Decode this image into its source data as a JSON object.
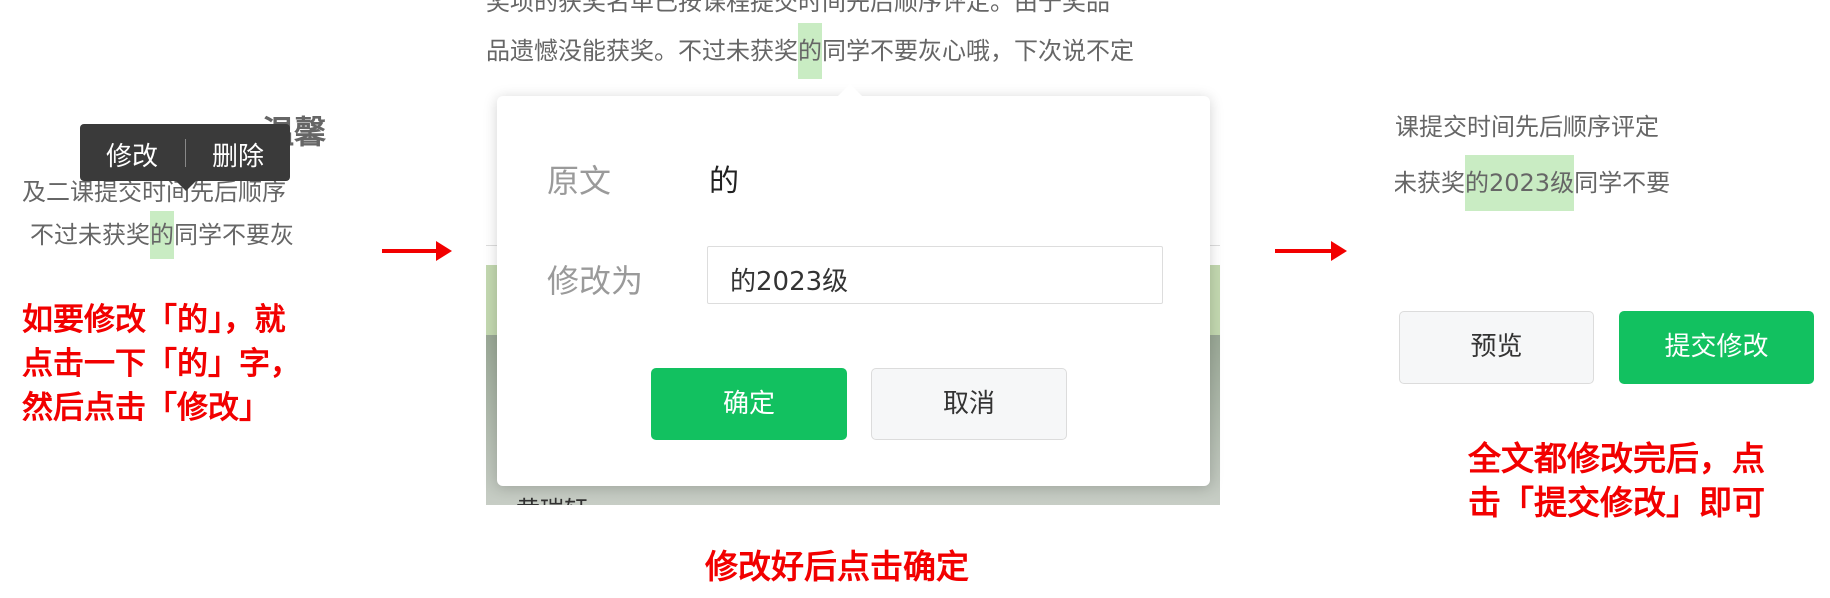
{
  "panel1": {
    "heading_fragment": "温馨",
    "tooltip": {
      "edit_label": "修改",
      "delete_label": "删除"
    },
    "line1": "及二课提交时间先后顺序",
    "line2_before": "不过未获奖",
    "line2_highlight": "的",
    "line2_after": "同学不要灰",
    "instruction": [
      "如要修改「的」，就",
      "点击一下「的」字，",
      "然后点击「修改」"
    ]
  },
  "panel2": {
    "top_line_partial": "奖项的获奖名单已按课程提交时间先后顺序评定。由于奖品",
    "line_before": "品遗憾没能获奖。不过未获奖",
    "line_highlight": "的",
    "line_after": "同学不要灰心哦，下次说不定",
    "dialog": {
      "original_label": "原文",
      "original_value": "的",
      "modify_label": "修改为",
      "modify_value": "的2023级",
      "confirm_label": "确定",
      "cancel_label": "取消"
    },
    "bottom_partial_text": "黄瑞轩",
    "instruction": "修改好后点击确定"
  },
  "panel3": {
    "line1": "课提交时间先后顺序评定",
    "line2_before": "未获奖",
    "line2_highlight": "的2023级",
    "line2_after": "同学不要",
    "preview_label": "预览",
    "submit_label": "提交修改",
    "instruction": [
      "全文都修改完后，点",
      "击「提交修改」即可"
    ]
  },
  "colors": {
    "accent_green": "#12c160",
    "highlight_green": "#c9ecc3",
    "instruction_red": "#f20000",
    "tooltip_bg": "#3a3a3a"
  }
}
